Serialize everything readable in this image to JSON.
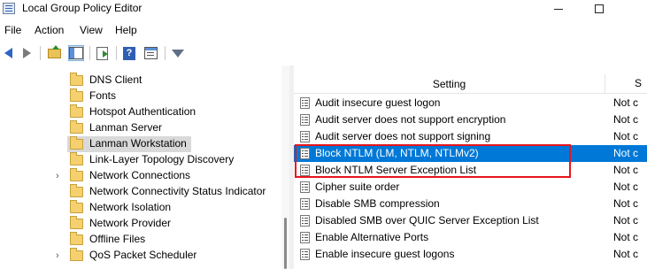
{
  "window": {
    "title": "Local Group Policy Editor",
    "controls": {
      "minimize": "minimize",
      "maximize": "maximize",
      "close": "close"
    }
  },
  "menu": [
    "File",
    "Action",
    "View",
    "Help"
  ],
  "toolbar": {
    "icons": [
      "back-arrow-icon",
      "forward-arrow-icon",
      "up-folder-icon",
      "show-hide-tree-icon",
      "export-list-icon",
      "help-icon",
      "properties-icon",
      "filter-icon"
    ]
  },
  "tree": {
    "items": [
      {
        "label": "DNS Client",
        "expandable": false,
        "selected": false
      },
      {
        "label": "Fonts",
        "expandable": false,
        "selected": false
      },
      {
        "label": "Hotspot Authentication",
        "expandable": false,
        "selected": false
      },
      {
        "label": "Lanman Server",
        "expandable": false,
        "selected": false
      },
      {
        "label": "Lanman Workstation",
        "expandable": false,
        "selected": true
      },
      {
        "label": "Link-Layer Topology Discovery",
        "expandable": false,
        "selected": false
      },
      {
        "label": "Network Connections",
        "expandable": true,
        "selected": false
      },
      {
        "label": "Network Connectivity Status Indicator",
        "expandable": false,
        "selected": false
      },
      {
        "label": "Network Isolation",
        "expandable": false,
        "selected": false
      },
      {
        "label": "Network Provider",
        "expandable": false,
        "selected": false
      },
      {
        "label": "Offline Files",
        "expandable": false,
        "selected": false
      },
      {
        "label": "QoS Packet Scheduler",
        "expandable": true,
        "selected": false
      }
    ]
  },
  "list": {
    "columns": {
      "setting": "Setting",
      "state": "S"
    },
    "rows": [
      {
        "name": "Audit insecure guest logon",
        "state": "Not c",
        "selected": false
      },
      {
        "name": "Audit server does not support encryption",
        "state": "Not c",
        "selected": false
      },
      {
        "name": "Audit server does not support signing",
        "state": "Not c",
        "selected": false
      },
      {
        "name": "Block NTLM (LM, NTLM, NTLMv2)",
        "state": "Not c",
        "selected": true
      },
      {
        "name": "Block NTLM Server Exception List",
        "state": "Not c",
        "selected": false
      },
      {
        "name": "Cipher suite order",
        "state": "Not c",
        "selected": false
      },
      {
        "name": "Disable SMB compression",
        "state": "Not c",
        "selected": false
      },
      {
        "name": "Disabled SMB over QUIC Server Exception List",
        "state": "Not c",
        "selected": false
      },
      {
        "name": "Enable Alternative Ports",
        "state": "Not c",
        "selected": false
      },
      {
        "name": "Enable insecure guest logons",
        "state": "Not c",
        "selected": false
      }
    ]
  },
  "colors": {
    "selection": "#0078d7",
    "tree_selection": "#d9d9d9",
    "annotation_box": "#e8141c"
  }
}
